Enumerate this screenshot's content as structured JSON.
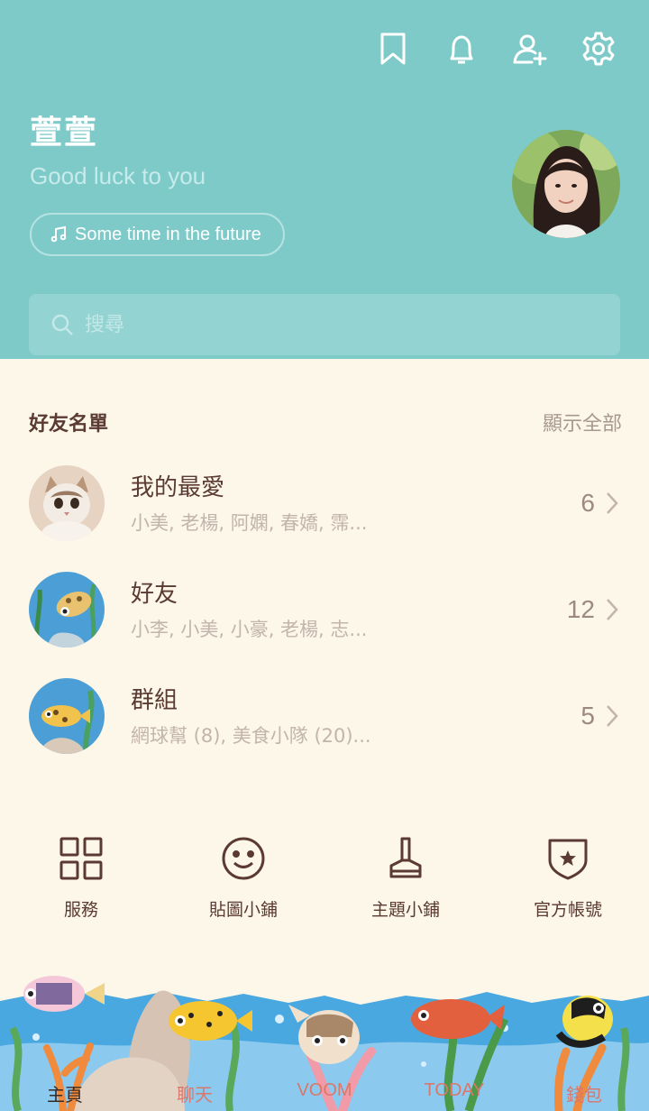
{
  "profile": {
    "name": "萱萱",
    "status_message": "Good luck to you",
    "music": "Some time in the future"
  },
  "header": {
    "icons": [
      "bookmark-icon",
      "bell-icon",
      "add-friend-icon",
      "settings-icon"
    ]
  },
  "search": {
    "placeholder": "搜尋"
  },
  "friends_section": {
    "title": "好友名單",
    "show_all": "顯示全部",
    "rows": [
      {
        "title": "我的最愛",
        "subtitle": "小美, 老楊, 阿嫻, 春嬌, 霈...",
        "count": "6"
      },
      {
        "title": "好友",
        "subtitle": "小李, 小美, 小豪, 老楊, 志...",
        "count": "12"
      },
      {
        "title": "群組",
        "subtitle": "網球幫 (8), 美食小隊 (20)...",
        "count": "5"
      }
    ]
  },
  "services": [
    {
      "label": "服務",
      "icon": "grid-icon"
    },
    {
      "label": "貼圖小鋪",
      "icon": "smiley-icon"
    },
    {
      "label": "主題小鋪",
      "icon": "brush-icon"
    },
    {
      "label": "官方帳號",
      "icon": "shield-star-icon"
    }
  ],
  "tabs": [
    {
      "label": "主頁"
    },
    {
      "label": "聊天"
    },
    {
      "label": "VOOM"
    },
    {
      "label": "TODAY"
    },
    {
      "label": "錢包"
    }
  ],
  "colors": {
    "header_bg": "#7ecac9",
    "body_bg": "#fdf7e9",
    "text_primary": "#5a3a33",
    "text_secondary": "#c3b4ac",
    "tab_inactive": "#d9786a"
  }
}
